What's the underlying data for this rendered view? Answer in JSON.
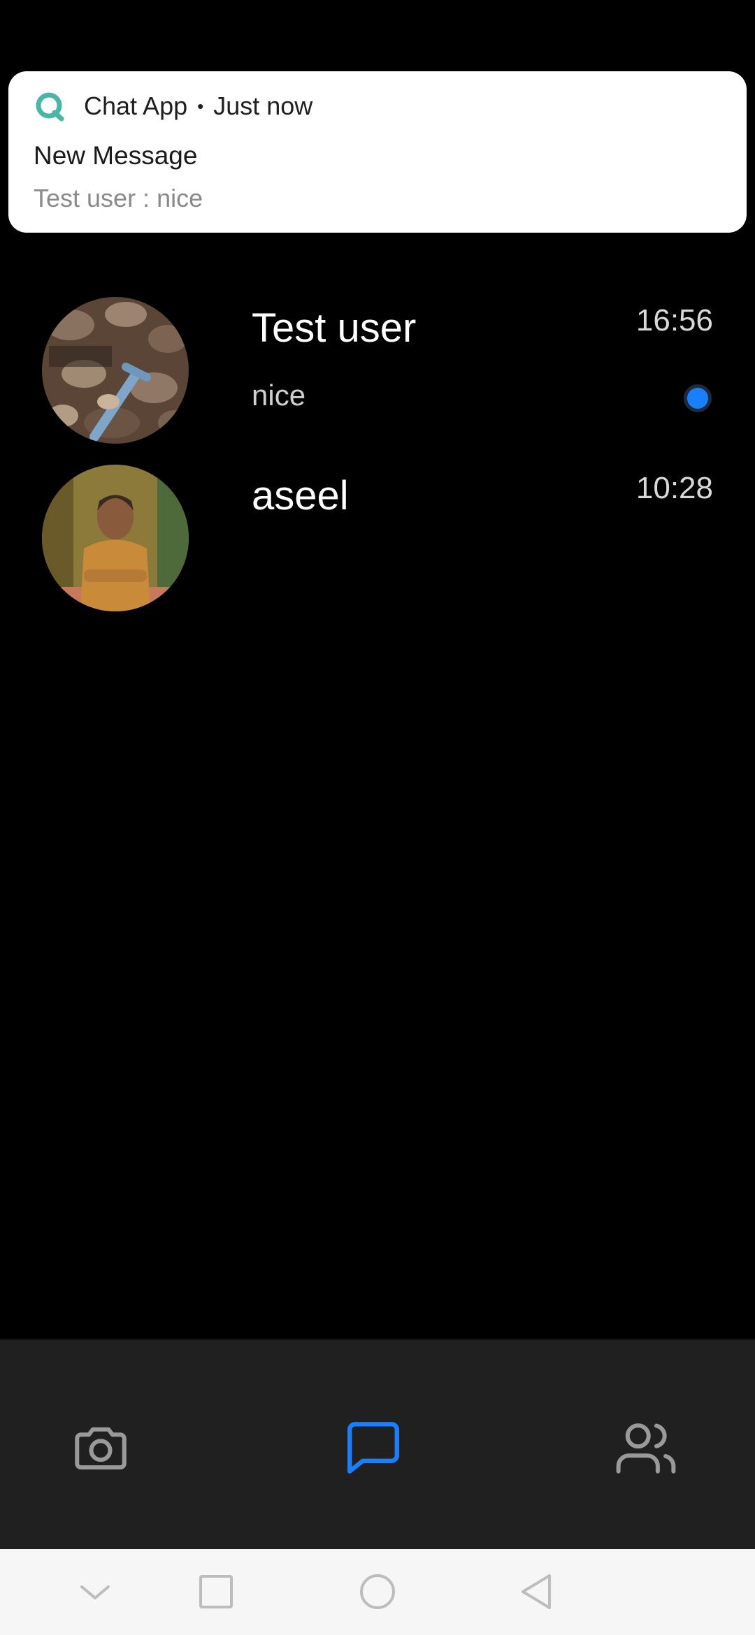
{
  "notification": {
    "app_name": "Chat App",
    "separator": "•",
    "time": "Just now",
    "title": "New Message",
    "body": "Test user : nice",
    "icon": "chat-app-logo-icon",
    "accent": "#4bb5a6"
  },
  "chats": [
    {
      "name": "Test user",
      "time": "16:56",
      "preview": "nice",
      "unread": true,
      "avatar": "rocks-photo-avatar"
    },
    {
      "name": "aseel",
      "time": "10:28",
      "preview": "",
      "unread": false,
      "avatar": "person-photo-avatar"
    }
  ],
  "bottom_nav": {
    "items": [
      {
        "icon": "camera-icon",
        "active": false
      },
      {
        "icon": "chat-bubble-icon",
        "active": true
      },
      {
        "icon": "people-icon",
        "active": false
      }
    ],
    "active_color": "#1a7fff",
    "inactive_color": "#9a9a9a"
  },
  "system_nav": {
    "items": [
      "chevron-down-icon",
      "recents-square-icon",
      "home-circle-icon",
      "back-triangle-icon"
    ]
  }
}
